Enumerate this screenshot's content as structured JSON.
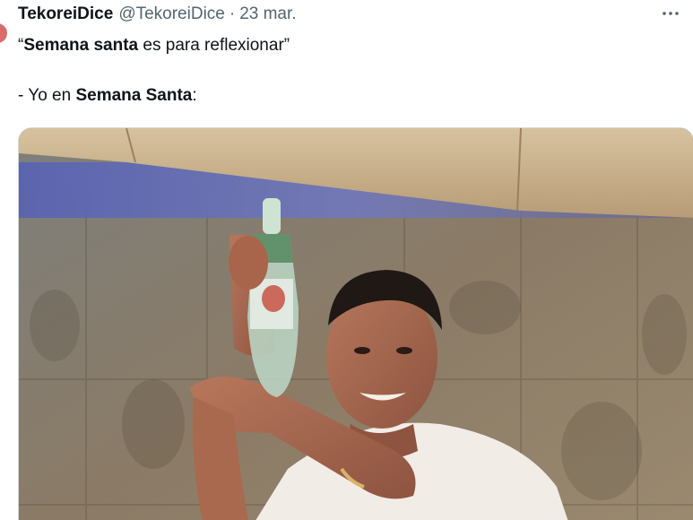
{
  "tweet": {
    "display_name": "TekoreiDice",
    "handle": "@TekoreiDice",
    "separator": "·",
    "timestamp": "23 mar.",
    "more_icon": "more-horizontal-icon",
    "text": {
      "line1_open_quote": "“",
      "line1_bold": "Semana santa",
      "line1_rest": " es para reflexionar”",
      "line2_prefix": "- Yo en ",
      "line2_bold": "Semana Santa",
      "line2_suffix": ":"
    },
    "media": {
      "kind": "video-still",
      "subject": "man-holding-bottle"
    }
  }
}
